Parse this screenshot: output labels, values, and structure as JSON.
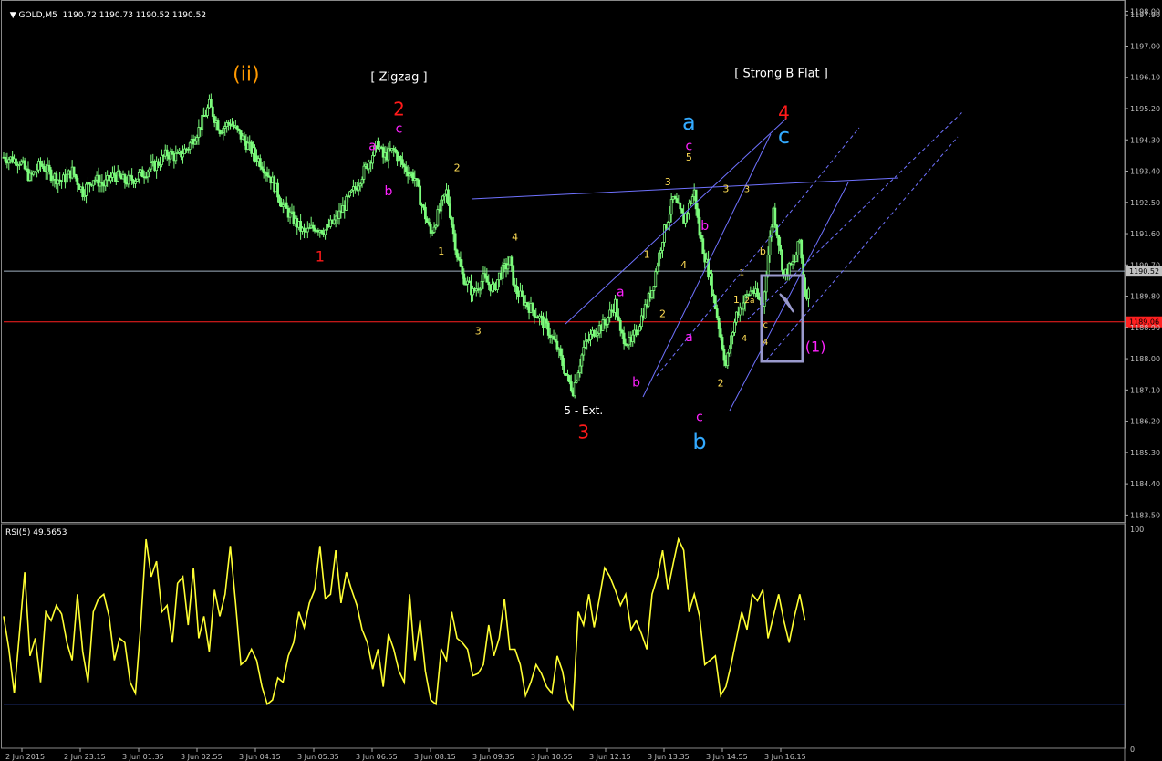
{
  "header": {
    "symbol": "GOLD,M5",
    "ohlc": "1190.72 1190.73 1190.52 1190.52",
    "rsi_label": "RSI(5) 49.5653"
  },
  "colors": {
    "bg": "#000000",
    "candle": "#7CFC7C",
    "axis": "#c0c0c0",
    "price_line": "#9fb0c0",
    "red_line": "#ff2020",
    "channel": "#6f72ff",
    "rsi": "#ffff33",
    "rsi_level": "#3a5bd9",
    "box": "#9a9acd"
  },
  "chart_data": [
    {
      "type": "candlestick",
      "symbol": "GOLD",
      "timeframe": "M5",
      "ylim": [
        1183.3,
        1198.3
      ],
      "y_ticks": [
        "1198.00",
        "1197.90",
        "1197.00",
        "1196.10",
        "1195.20",
        "1194.30",
        "1193.40",
        "1192.50",
        "1191.60",
        "1190.70",
        "1190.52",
        "1189.80",
        "1189.06",
        "1188.90",
        "1188.00",
        "1187.10",
        "1186.20",
        "1185.30",
        "1184.40",
        "1183.50"
      ],
      "x_ticks": [
        "2 Jun 2015",
        "2 Jun 23:15",
        "3 Jun 01:35",
        "3 Jun 02:55",
        "3 Jun 04:15",
        "3 Jun 05:35",
        "3 Jun 06:55",
        "3 Jun 08:15",
        "3 Jun 09:35",
        "3 Jun 10:55",
        "3 Jun 12:15",
        "3 Jun 13:35",
        "3 Jun 14:55",
        "3 Jun 16:15"
      ],
      "current_price": 1190.52,
      "red_level": 1189.06,
      "close_path_points": [
        [
          0,
          1193.8
        ],
        [
          3,
          1193.7
        ],
        [
          5,
          1193.2
        ],
        [
          7,
          1193.6
        ],
        [
          9,
          1193.3
        ],
        [
          11,
          1193.1
        ],
        [
          13,
          1193.4
        ],
        [
          15,
          1192.8
        ],
        [
          17,
          1193.2
        ],
        [
          19,
          1193.0
        ],
        [
          21,
          1193.3
        ],
        [
          23,
          1193.1
        ],
        [
          25,
          1193.2
        ],
        [
          27,
          1193.4
        ],
        [
          29,
          1193.6
        ],
        [
          31,
          1193.9
        ],
        [
          33,
          1193.8
        ],
        [
          35,
          1194.1
        ],
        [
          37,
          1194.6
        ],
        [
          39,
          1195.3
        ],
        [
          41,
          1194.6
        ],
        [
          43,
          1194.8
        ],
        [
          45,
          1194.4
        ],
        [
          47,
          1194.0
        ],
        [
          49,
          1193.6
        ],
        [
          51,
          1193.1
        ],
        [
          53,
          1192.4
        ],
        [
          55,
          1192.0
        ],
        [
          57,
          1191.6
        ],
        [
          59,
          1191.8
        ],
        [
          61,
          1191.7
        ],
        [
          63,
          1192.0
        ],
        [
          65,
          1192.5
        ],
        [
          67,
          1193.0
        ],
        [
          69,
          1193.6
        ],
        [
          71,
          1194.2
        ],
        [
          72,
          1193.8
        ],
        [
          74,
          1194.0
        ],
        [
          76,
          1193.5
        ],
        [
          78,
          1193.2
        ],
        [
          79,
          1192.6
        ],
        [
          81,
          1191.6
        ],
        [
          83,
          1192.4
        ],
        [
          84,
          1192.8
        ],
        [
          86,
          1191.0
        ],
        [
          87,
          1190.4
        ],
        [
          89,
          1189.9
        ],
        [
          91,
          1190.3
        ],
        [
          93,
          1190.0
        ],
        [
          94,
          1190.4
        ],
        [
          96,
          1190.8
        ],
        [
          97,
          1190.0
        ],
        [
          99,
          1189.6
        ],
        [
          101,
          1189.3
        ],
        [
          103,
          1188.9
        ],
        [
          105,
          1188.3
        ],
        [
          107,
          1187.4
        ],
        [
          108,
          1187.1
        ],
        [
          110,
          1188.3
        ],
        [
          112,
          1188.8
        ],
        [
          114,
          1189.0
        ],
        [
          116,
          1189.6
        ],
        [
          117,
          1188.7
        ],
        [
          119,
          1188.4
        ],
        [
          121,
          1189.2
        ],
        [
          123,
          1190.0
        ],
        [
          125,
          1191.5
        ],
        [
          127,
          1192.6
        ],
        [
          129,
          1192.0
        ],
        [
          131,
          1192.8
        ],
        [
          132,
          1191.6
        ],
        [
          134,
          1190.3
        ],
        [
          135,
          1189.5
        ],
        [
          137,
          1187.8
        ],
        [
          139,
          1189.3
        ],
        [
          141,
          1189.8
        ],
        [
          142,
          1190.0
        ],
        [
          144,
          1189.5
        ],
        [
          145,
          1191.0
        ],
        [
          146,
          1192.3
        ],
        [
          148,
          1190.4
        ],
        [
          150,
          1190.8
        ],
        [
          151,
          1191.4
        ],
        [
          152,
          1189.9
        ]
      ],
      "x_range": [
        0,
        152
      ],
      "annotations": [
        {
          "text": "(ii)",
          "color": "#ff9900",
          "size": 22,
          "x": 46,
          "y": 1196.0
        },
        {
          "text": "[ Zigzag ]",
          "color": "#ffffff",
          "size": 13,
          "x": 75,
          "y": 1196.0
        },
        {
          "text": "2",
          "color": "#ff1a1a",
          "size": 20,
          "x": 75,
          "y": 1195.0
        },
        {
          "text": "c",
          "color": "#ff22ff",
          "size": 14,
          "x": 75,
          "y": 1194.5
        },
        {
          "text": "a",
          "color": "#ff22ff",
          "size": 14,
          "x": 70,
          "y": 1194.0
        },
        {
          "text": "b",
          "color": "#ff22ff",
          "size": 14,
          "x": 73,
          "y": 1192.7
        },
        {
          "text": "1",
          "color": "#ff1a1a",
          "size": 16,
          "x": 60,
          "y": 1190.8
        },
        {
          "text": "2",
          "color": "#ffdd55",
          "size": 11,
          "x": 86,
          "y": 1193.4
        },
        {
          "text": "1",
          "color": "#ffdd55",
          "size": 11,
          "x": 83,
          "y": 1191.0
        },
        {
          "text": "4",
          "color": "#ffdd55",
          "size": 11,
          "x": 97,
          "y": 1191.4
        },
        {
          "text": "3",
          "color": "#ffdd55",
          "size": 11,
          "x": 90,
          "y": 1188.7
        },
        {
          "text": "5 - Ext.",
          "color": "#ffffff",
          "size": 12,
          "x": 110,
          "y": 1186.4
        },
        {
          "text": "3",
          "color": "#ff1a1a",
          "size": 20,
          "x": 110,
          "y": 1185.7
        },
        {
          "text": "a",
          "color": "#ff22ff",
          "size": 14,
          "x": 117,
          "y": 1189.8
        },
        {
          "text": "b",
          "color": "#ff22ff",
          "size": 14,
          "x": 120,
          "y": 1187.2
        },
        {
          "text": "2",
          "color": "#ffdd55",
          "size": 11,
          "x": 125,
          "y": 1189.2
        },
        {
          "text": "1",
          "color": "#ffdd55",
          "size": 11,
          "x": 122,
          "y": 1190.9
        },
        {
          "text": "3",
          "color": "#ffdd55",
          "size": 11,
          "x": 126,
          "y": 1193.0
        },
        {
          "text": "4",
          "color": "#ffdd55",
          "size": 11,
          "x": 129,
          "y": 1190.6
        },
        {
          "text": "5",
          "color": "#ffdd55",
          "size": 11,
          "x": 130,
          "y": 1193.7
        },
        {
          "text": "c",
          "color": "#ff22ff",
          "size": 14,
          "x": 130,
          "y": 1194.0
        },
        {
          "text": "a",
          "color": "#33aaff",
          "size": 24,
          "x": 130,
          "y": 1194.6
        },
        {
          "text": "b",
          "color": "#ff22ff",
          "size": 14,
          "x": 133,
          "y": 1191.7
        },
        {
          "text": "a",
          "color": "#ff22ff",
          "size": 14,
          "x": 130,
          "y": 1188.5
        },
        {
          "text": "c",
          "color": "#ff22ff",
          "size": 14,
          "x": 132,
          "y": 1186.2
        },
        {
          "text": "b",
          "color": "#33aaff",
          "size": 24,
          "x": 132,
          "y": 1185.4
        },
        {
          "text": "2",
          "color": "#ffdd55",
          "size": 11,
          "x": 136,
          "y": 1187.2
        },
        {
          "text": "3",
          "color": "#ffdd55",
          "size": 11,
          "x": 137,
          "y": 1192.8
        },
        {
          "text": "1",
          "color": "#ffdd55",
          "size": 11,
          "x": 139,
          "y": 1189.6
        },
        {
          "text": "3",
          "color": "#ffdd55",
          "size": 10,
          "x": 141,
          "y": 1192.8
        },
        {
          "text": "1",
          "color": "#ffdd55",
          "size": 9,
          "x": 140,
          "y": 1190.4
        },
        {
          "text": "2a",
          "color": "#ffdd55",
          "size": 9,
          "x": 141.5,
          "y": 1189.6
        },
        {
          "text": "b",
          "color": "#ffdd55",
          "size": 11,
          "x": 144,
          "y": 1191.0
        },
        {
          "text": "c",
          "color": "#ffdd55",
          "size": 10,
          "x": 144.5,
          "y": 1188.9
        },
        {
          "text": "4",
          "color": "#ffdd55",
          "size": 10,
          "x": 140.5,
          "y": 1188.5
        },
        {
          "text": "4",
          "color": "#ffdd55",
          "size": 10,
          "x": 144.5,
          "y": 1188.4
        },
        {
          "text": "[ Strong B Flat ]",
          "color": "#ffffff",
          "size": 13,
          "x": 147.5,
          "y": 1196.1
        },
        {
          "text": "4",
          "color": "#ff1a1a",
          "size": 20,
          "x": 148,
          "y": 1194.9
        },
        {
          "text": "c",
          "color": "#33aaff",
          "size": 24,
          "x": 148,
          "y": 1194.2
        },
        {
          "text": "(1)",
          "color": "#ff22ff",
          "size": 16,
          "x": 154,
          "y": 1188.2
        }
      ]
    },
    {
      "type": "line",
      "title": "RSI(5) 49.5653",
      "ylim": [
        0,
        100
      ],
      "y_ticks": [
        "100",
        "0"
      ],
      "level": 20,
      "values": [
        60,
        45,
        25,
        52,
        80,
        42,
        50,
        30,
        62,
        58,
        65,
        61,
        48,
        40,
        70,
        44,
        30,
        62,
        68,
        70,
        60,
        40,
        50,
        48,
        30,
        25,
        56,
        95,
        78,
        85,
        62,
        65,
        48,
        75,
        78,
        56,
        82,
        50,
        60,
        44,
        72,
        60,
        70,
        92,
        66,
        38,
        40,
        45,
        40,
        28,
        20,
        22,
        32,
        30,
        42,
        48,
        62,
        55,
        66,
        72,
        92,
        68,
        70,
        90,
        66,
        80,
        72,
        65,
        54,
        48,
        36,
        45,
        28,
        52,
        45,
        35,
        30,
        70,
        40,
        58,
        35,
        22,
        20,
        45,
        40,
        62,
        50,
        48,
        45,
        33,
        34,
        38,
        56,
        42,
        50,
        68,
        45,
        45,
        38,
        24,
        30,
        38,
        34,
        28,
        25,
        42,
        35,
        22,
        18,
        62,
        56,
        70,
        55,
        68,
        82,
        78,
        72,
        65,
        70,
        54,
        58,
        52,
        45,
        70,
        78,
        90,
        72,
        84,
        95,
        90,
        62,
        70,
        60,
        38,
        40,
        42,
        24,
        28,
        38,
        50,
        62,
        54,
        70,
        67,
        72,
        50,
        60,
        70,
        58,
        48,
        60,
        70,
        58
      ]
    }
  ]
}
